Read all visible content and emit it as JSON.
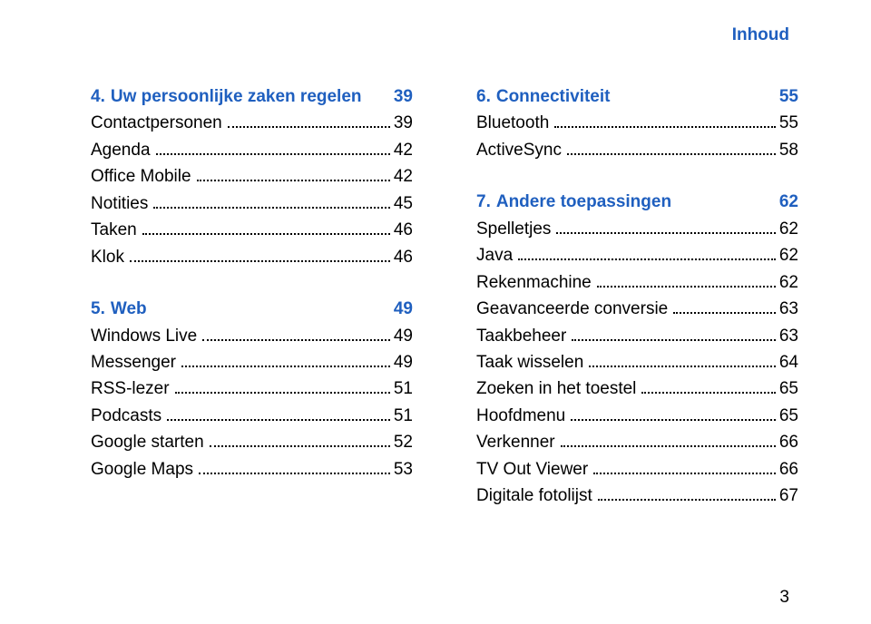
{
  "header": "Inhoud",
  "footer_page": "3",
  "left": {
    "section1": {
      "num": "4.",
      "title": "Uw persoonlijke zaken regelen",
      "page": "39"
    },
    "items1": [
      {
        "label": "Contactpersonen",
        "page": "39"
      },
      {
        "label": "Agenda",
        "page": "42"
      },
      {
        "label": "Office Mobile",
        "page": "42"
      },
      {
        "label": "Notities",
        "page": "45"
      },
      {
        "label": "Taken",
        "page": "46"
      },
      {
        "label": "Klok",
        "page": "46"
      }
    ],
    "section2": {
      "num": "5.",
      "title": "Web",
      "page": "49"
    },
    "items2": [
      {
        "label": "Windows Live",
        "page": "49"
      },
      {
        "label": "Messenger",
        "page": "49"
      },
      {
        "label": "RSS-lezer",
        "page": "51"
      },
      {
        "label": "Podcasts",
        "page": "51"
      },
      {
        "label": "Google starten",
        "page": "52"
      },
      {
        "label": "Google Maps",
        "page": "53"
      }
    ]
  },
  "right": {
    "section1": {
      "num": "6.",
      "title": "Connectiviteit",
      "page": "55"
    },
    "items1": [
      {
        "label": "Bluetooth",
        "page": "55"
      },
      {
        "label": "ActiveSync",
        "page": "58"
      }
    ],
    "section2": {
      "num": "7.",
      "title": "Andere toepassingen",
      "page": "62"
    },
    "items2": [
      {
        "label": "Spelletjes",
        "page": "62"
      },
      {
        "label": "Java",
        "page": "62"
      },
      {
        "label": "Rekenmachine",
        "page": "62"
      },
      {
        "label": "Geavanceerde conversie",
        "page": "63"
      },
      {
        "label": "Taakbeheer",
        "page": "63"
      },
      {
        "label": "Taak wisselen",
        "page": "64"
      },
      {
        "label": "Zoeken in het toestel",
        "page": "65"
      },
      {
        "label": "Hoofdmenu",
        "page": "65"
      },
      {
        "label": "Verkenner",
        "page": "66"
      },
      {
        "label": "TV Out Viewer",
        "page": "66"
      },
      {
        "label": "Digitale fotolijst",
        "page": "67"
      }
    ]
  }
}
